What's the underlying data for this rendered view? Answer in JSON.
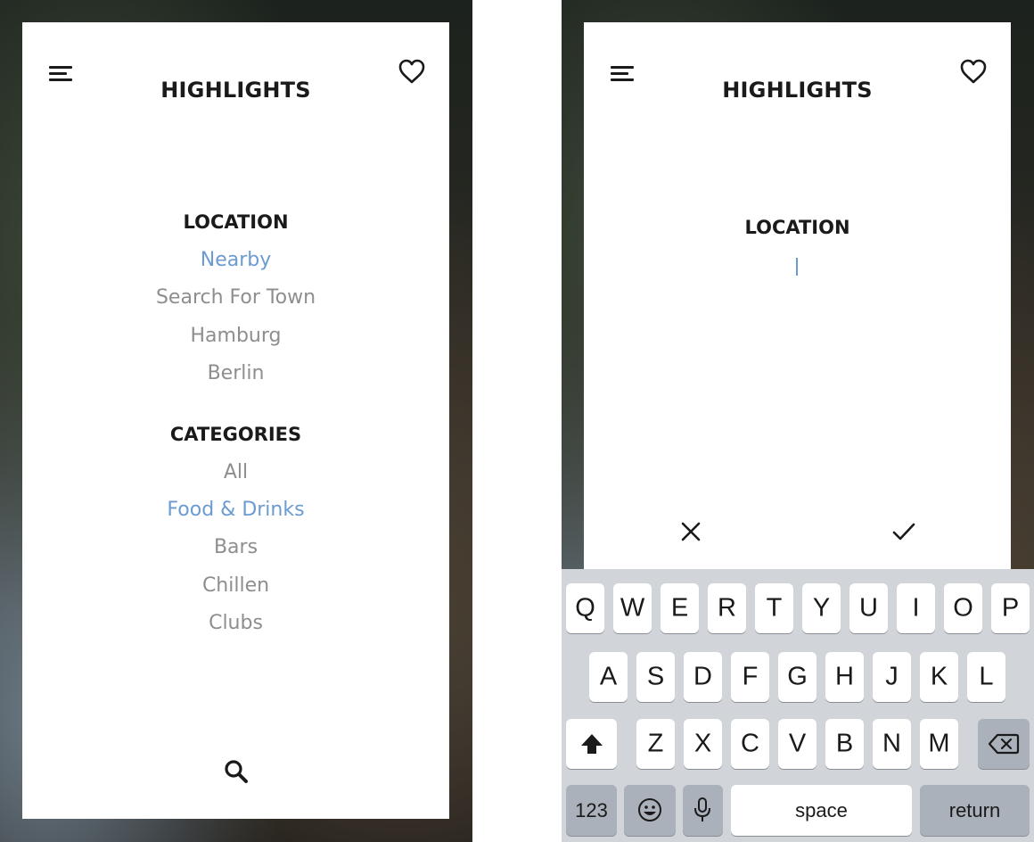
{
  "left_screen": {
    "header": {
      "title": "HIGHLIGHTS",
      "menu_icon": "menu-icon",
      "favorite_icon": "heart-icon"
    },
    "location": {
      "title": "LOCATION",
      "options": [
        {
          "label": "Nearby",
          "selected": true
        },
        {
          "label": "Search For Town",
          "selected": false
        },
        {
          "label": "Hamburg",
          "selected": false
        },
        {
          "label": "Berlin",
          "selected": false
        }
      ]
    },
    "categories": {
      "title": "CATEGORIES",
      "options": [
        {
          "label": "All",
          "selected": false
        },
        {
          "label": "Food & Drinks",
          "selected": true
        },
        {
          "label": "Bars",
          "selected": false
        },
        {
          "label": "Chillen",
          "selected": false
        },
        {
          "label": "Clubs",
          "selected": false
        }
      ]
    },
    "footer": {
      "search_icon": "search-icon"
    }
  },
  "right_screen": {
    "header": {
      "title": "HIGHLIGHTS",
      "menu_icon": "menu-icon",
      "favorite_icon": "heart-icon"
    },
    "location": {
      "title": "LOCATION",
      "input_value": ""
    },
    "actions": {
      "cancel_icon": "close-icon",
      "confirm_icon": "checkmark-icon"
    },
    "keyboard": {
      "row1": [
        "Q",
        "W",
        "E",
        "R",
        "T",
        "Y",
        "U",
        "I",
        "O",
        "P"
      ],
      "row2": [
        "A",
        "S",
        "D",
        "F",
        "G",
        "H",
        "J",
        "K",
        "L"
      ],
      "row3": [
        "Z",
        "X",
        "C",
        "V",
        "B",
        "N",
        "M"
      ],
      "shift_icon": "shift-icon",
      "backspace_icon": "backspace-icon",
      "numbers_label": "123",
      "emoji_icon": "emoji-icon",
      "mic_icon": "microphone-icon",
      "space_label": "space",
      "return_label": "return"
    }
  },
  "colors": {
    "accent": "#6b9bd1",
    "inactive_text": "#8e8e8e",
    "title_text": "#1a1a1a",
    "keyboard_bg": "#d1d4d9"
  }
}
